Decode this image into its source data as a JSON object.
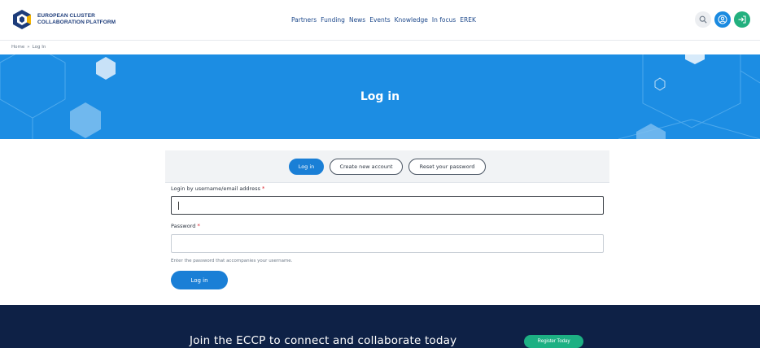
{
  "header": {
    "logo_line1": "EUROPEAN CLUSTER",
    "logo_line2": "COLLABORATION PLATFORM",
    "nav": [
      "Partners",
      "Funding",
      "News",
      "Events",
      "Knowledge",
      "In focus",
      "EREK"
    ],
    "icons": [
      "search-icon",
      "user-icon",
      "login-icon"
    ],
    "colors": {
      "accent": "#1a8ae0",
      "login": "#22b07e"
    }
  },
  "breadcrumb": {
    "home": "Home",
    "separator": "»",
    "current": "Log In"
  },
  "hero": {
    "title": "Log in",
    "color": "#1c8de3"
  },
  "tabs": [
    {
      "label": "Log in",
      "active": true
    },
    {
      "label": "Create new account",
      "active": false
    },
    {
      "label": "Reset your password",
      "active": false
    }
  ],
  "form": {
    "username_label": "Login by username/email address",
    "username_value": "",
    "password_label": "Password",
    "password_value": "",
    "required_mark": "*",
    "password_hint": "Enter the password that accompanies your username.",
    "submit_label": "Log in"
  },
  "footer": {
    "cta_text": "Join the ECCP to connect and collaborate today",
    "register_label": "Register Today",
    "background": "#0e2146",
    "button_color": "#1db083"
  }
}
